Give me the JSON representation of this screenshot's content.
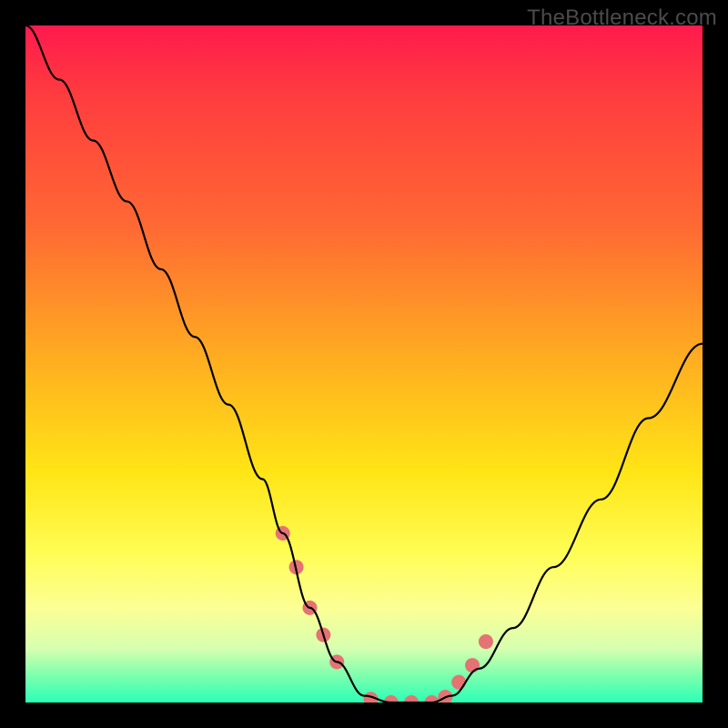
{
  "watermark": "TheBottleneck.com",
  "chart_data": {
    "type": "line",
    "title": "",
    "xlabel": "",
    "ylabel": "",
    "xlim": [
      0,
      100
    ],
    "ylim": [
      0,
      100
    ],
    "series": [
      {
        "name": "bottleneck-curve",
        "x": [
          0,
          5,
          10,
          15,
          20,
          25,
          30,
          35,
          38,
          42,
          46,
          50,
          54,
          58,
          60,
          63,
          67,
          72,
          78,
          85,
          92,
          100
        ],
        "values": [
          100,
          92,
          83,
          74,
          64,
          54,
          44,
          33,
          25,
          14,
          6,
          1,
          0,
          0,
          0,
          1,
          5,
          11,
          20,
          30,
          42,
          53
        ]
      }
    ],
    "markers": {
      "name": "highlight-dots",
      "x": [
        38,
        40,
        42,
        44,
        46,
        51,
        54,
        57,
        60,
        62,
        64,
        66,
        68
      ],
      "values": [
        25,
        20,
        14,
        10,
        6,
        0.5,
        0,
        0,
        0,
        0.8,
        3,
        5.5,
        9
      ],
      "color": "#e57373",
      "radius_px": 8
    },
    "gradient_stops": [
      {
        "pos": 0.0,
        "color": "#ff1a4d"
      },
      {
        "pos": 0.1,
        "color": "#ff3b3f"
      },
      {
        "pos": 0.3,
        "color": "#ff6a33"
      },
      {
        "pos": 0.5,
        "color": "#ffb020"
      },
      {
        "pos": 0.66,
        "color": "#ffe516"
      },
      {
        "pos": 0.78,
        "color": "#fffd55"
      },
      {
        "pos": 0.86,
        "color": "#fcff94"
      },
      {
        "pos": 0.92,
        "color": "#d7ffb0"
      },
      {
        "pos": 0.96,
        "color": "#7dffad"
      },
      {
        "pos": 1.0,
        "color": "#2bffb7"
      }
    ]
  }
}
